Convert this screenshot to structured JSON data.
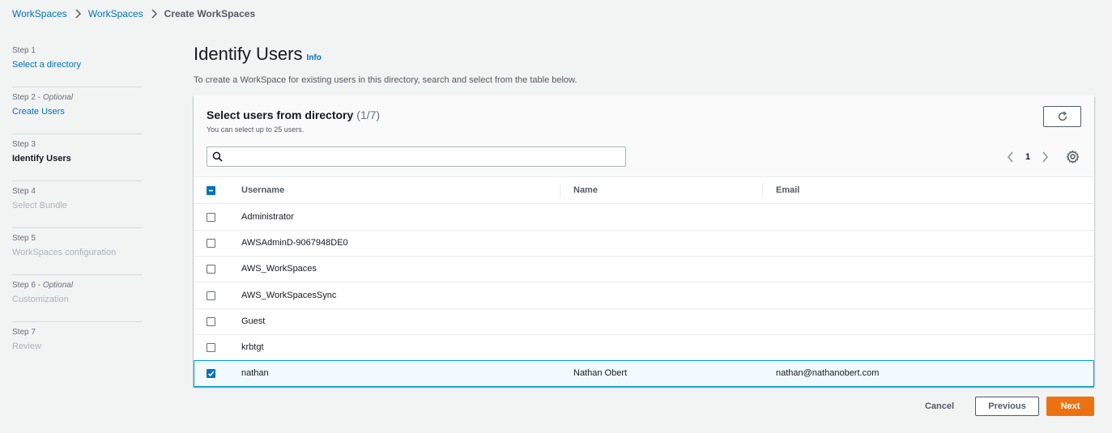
{
  "breadcrumb": {
    "items": [
      "WorkSpaces",
      "WorkSpaces"
    ],
    "current": "Create WorkSpaces"
  },
  "steps": [
    {
      "num": "Step 1",
      "optional": "",
      "label": "Select a directory",
      "state": "link"
    },
    {
      "num": "Step 2 - ",
      "optional": "Optional",
      "label": "Create Users",
      "state": "link"
    },
    {
      "num": "Step 3",
      "optional": "",
      "label": "Identify Users",
      "state": "current"
    },
    {
      "num": "Step 4",
      "optional": "",
      "label": "Select Bundle",
      "state": "disabled"
    },
    {
      "num": "Step 5",
      "optional": "",
      "label": "WorkSpaces configuration",
      "state": "disabled"
    },
    {
      "num": "Step 6 - ",
      "optional": "Optional",
      "label": "Customization",
      "state": "disabled"
    },
    {
      "num": "Step 7",
      "optional": "",
      "label": "Review",
      "state": "disabled"
    }
  ],
  "page": {
    "title": "Identify Users",
    "info": "Info",
    "description": "To create a WorkSpace for existing users in this directory, search and select from the table below."
  },
  "table": {
    "title": "Select users from directory",
    "count": "(1/7)",
    "subtitle": "You can select up to 25 users.",
    "search_placeholder": "",
    "page": "1",
    "columns": [
      "Username",
      "Name",
      "Email"
    ],
    "rows": [
      {
        "username": "Administrator",
        "name": "",
        "email": "",
        "selected": false
      },
      {
        "username": "AWSAdminD-9067948DE0",
        "name": "",
        "email": "",
        "selected": false
      },
      {
        "username": "AWS_WorkSpaces",
        "name": "",
        "email": "",
        "selected": false
      },
      {
        "username": "AWS_WorkSpacesSync",
        "name": "",
        "email": "",
        "selected": false
      },
      {
        "username": "Guest",
        "name": "",
        "email": "",
        "selected": false
      },
      {
        "username": "krbtgt",
        "name": "",
        "email": "",
        "selected": false
      },
      {
        "username": "nathan",
        "name": "Nathan Obert",
        "email": "nathan@nathanobert.com",
        "selected": true
      }
    ]
  },
  "footer": {
    "cancel": "Cancel",
    "previous": "Previous",
    "next": "Next"
  },
  "icons": {
    "breadcrumb_separator": "chevron-right-icon",
    "refresh": "refresh-icon",
    "search": "search-icon",
    "prev_page": "chevron-left-icon",
    "next_page": "chevron-right-icon",
    "settings": "gear-icon"
  },
  "colors": {
    "link": "#0073bb",
    "primary_button": "#ec7211",
    "selected_row_bg": "#f1faff",
    "selected_row_border": "#00a1c9"
  }
}
